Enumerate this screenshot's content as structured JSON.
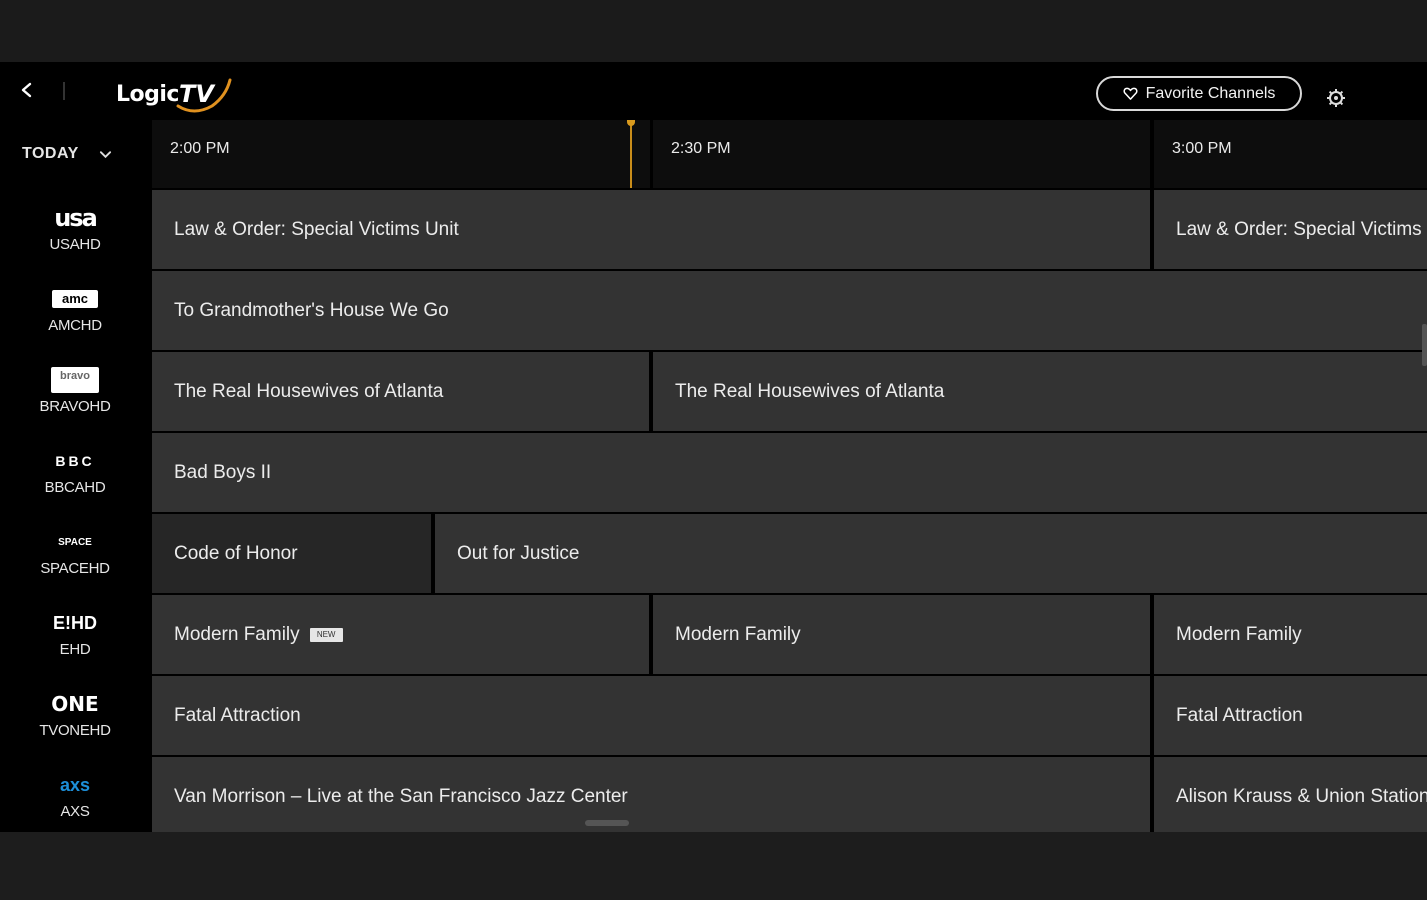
{
  "header": {
    "logo_text": "Logic",
    "logo_tv": "TV",
    "favorite_label": "Favorite Channels"
  },
  "sidebar": {
    "today_label": "TODAY",
    "channels": [
      {
        "logo": "usa",
        "name": "USAHD"
      },
      {
        "logo": "amc",
        "name": "AMCHD"
      },
      {
        "logo": "bravo",
        "name": "BRAVOHD"
      },
      {
        "logo": "BBC",
        "name": "BBCAHD"
      },
      {
        "logo": "SPACE",
        "name": "SPACEHD"
      },
      {
        "logo": "E!HD",
        "name": "EHD"
      },
      {
        "logo": "ONE",
        "name": "TVONEHD"
      },
      {
        "logo": "axs",
        "name": "AXS"
      }
    ]
  },
  "timebar": {
    "slots": [
      "2:00 PM",
      "2:30 PM",
      "3:00 PM"
    ]
  },
  "programs": {
    "row0": [
      "Law & Order: Special Victims Unit",
      "Law & Order: Special Victims Unit"
    ],
    "row1": [
      "To Grandmother's House We Go"
    ],
    "row2": [
      "The Real Housewives of Atlanta",
      "The Real Housewives of Atlanta"
    ],
    "row3": [
      "Bad Boys II"
    ],
    "row4": [
      "Code of Honor",
      "Out for Justice"
    ],
    "row5": [
      "Modern Family",
      "Modern Family",
      "Modern Family"
    ],
    "row6": [
      "Fatal Attraction",
      "Fatal Attraction"
    ],
    "row7": [
      "Van Morrison – Live at the San Francisco Jazz Center",
      "Alison Krauss & Union Station"
    ]
  },
  "badges": {
    "new": "NEW"
  },
  "colors": {
    "accent": "#d99a1e",
    "cell": "#333333",
    "background": "#000000"
  },
  "icons": [
    "chevron-left-icon",
    "heart-icon",
    "settings-icon",
    "chevron-down-icon"
  ]
}
